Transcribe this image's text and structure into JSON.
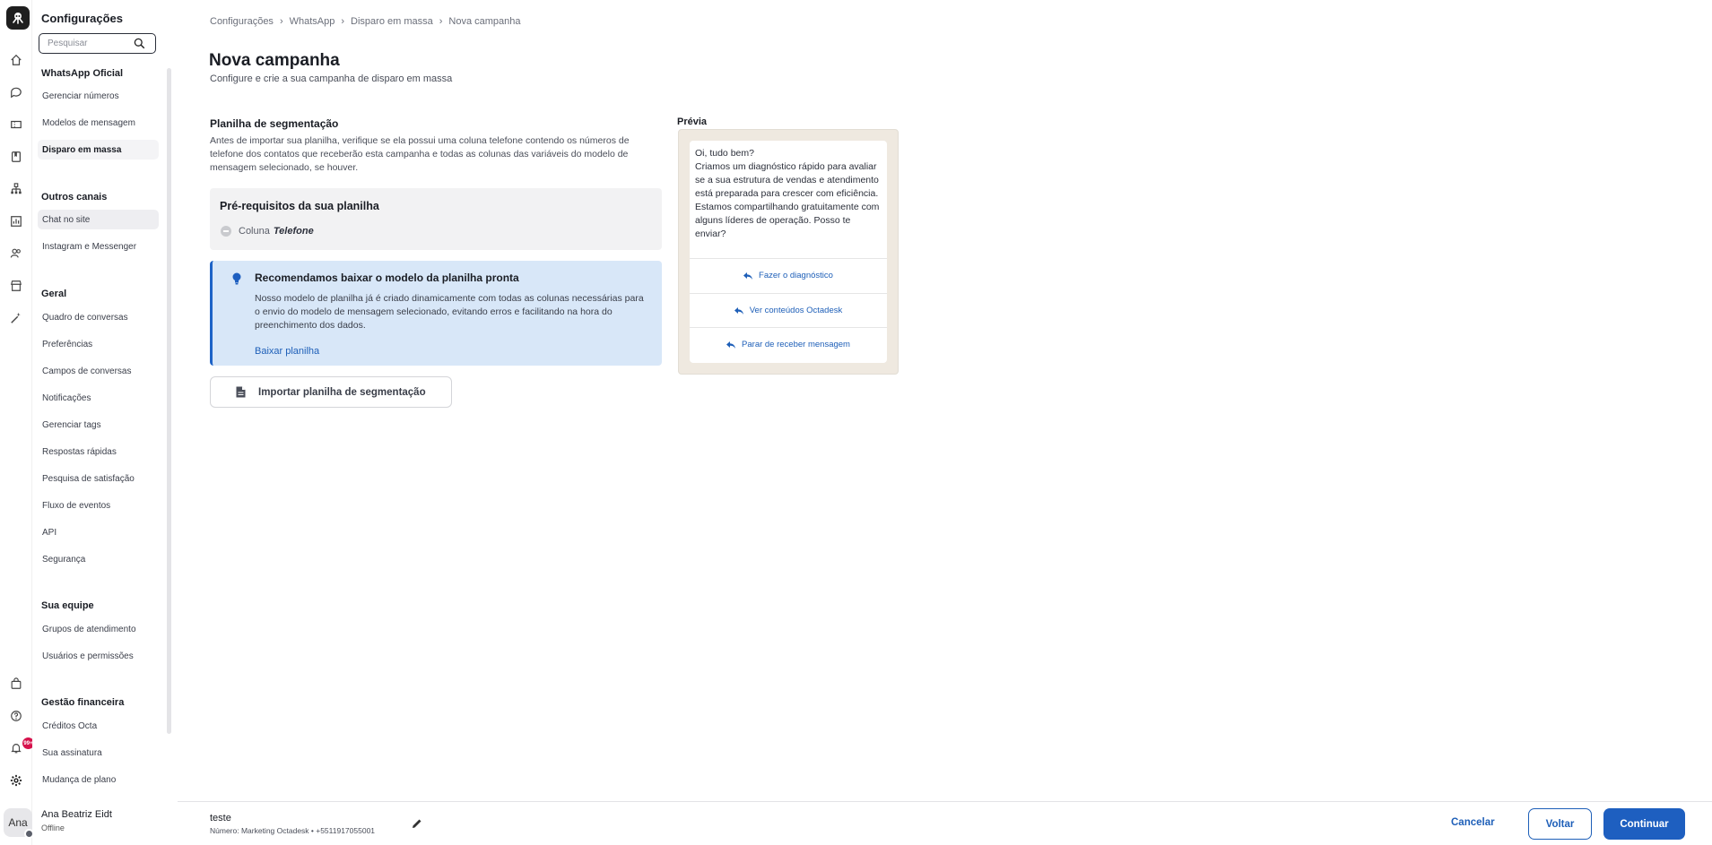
{
  "sidebar": {
    "title": "Configurações",
    "search_placeholder": "Pesquisar",
    "sections": [
      {
        "heading": "WhatsApp Oficial",
        "items": [
          "Gerenciar números",
          "Modelos de mensagem",
          "Disparo em massa"
        ]
      },
      {
        "heading": "Outros canais",
        "items": [
          "Chat no site",
          "Instagram e Messenger"
        ]
      },
      {
        "heading": "Geral",
        "items": [
          "Quadro de conversas",
          "Preferências",
          "Campos de conversas",
          "Notificações",
          "Gerenciar tags",
          "Respostas rápidas",
          "Pesquisa de satisfação",
          "Fluxo de eventos",
          "API",
          "Segurança"
        ]
      },
      {
        "heading": "Sua equipe",
        "items": [
          "Grupos de atendimento",
          "Usuários e permissões"
        ]
      },
      {
        "heading": "Gestão financeira",
        "items": [
          "Créditos Octa",
          "Sua assinatura",
          "Mudança de plano"
        ]
      }
    ],
    "active_item": "Disparo em massa"
  },
  "rail": {
    "notification_badge": "99+",
    "avatar_initials": "Ana"
  },
  "profile": {
    "name": "Ana Beatriz Eidt",
    "status": "Offline"
  },
  "breadcrumb": [
    "Configurações",
    "WhatsApp",
    "Disparo em massa",
    "Nova campanha"
  ],
  "page": {
    "title": "Nova campanha",
    "subtitle": "Configure e crie a sua campanha de disparo em massa"
  },
  "segmentation": {
    "title": "Planilha de segmentação",
    "description": "Antes de importar sua planilha, verifique se ela possui uma coluna telefone contendo os números de telefone dos contatos que receberão esta campanha e todas as colunas das variáveis do modelo de mensagem selecionado, se houver.",
    "prereq_title": "Pré-requisitos da sua planilha",
    "prereq_label": "Coluna",
    "prereq_value": "Telefone",
    "reco_title": "Recomendamos baixar o modelo da planilha pronta",
    "reco_text": "Nosso modelo de planilha já é criado dinamicamente com todas as colunas necessárias para o envio do modelo de mensagem selecionado, evitando erros e facilitando na hora do preenchimento dos dados.",
    "reco_link": "Baixar planilha",
    "import_button": "Importar planilha de segmentação"
  },
  "preview": {
    "label": "Prévia",
    "message": "Oi, tudo bem?\nCriamos um diagnóstico rápido para avaliar se a sua estrutura de vendas e atendimento está preparada para crescer com eficiência.\nEstamos compartilhando gratuitamente com alguns líderes de operação. Posso te enviar?",
    "replies": [
      "Fazer o diagnóstico",
      "Ver conteúdos Octadesk",
      "Parar de receber mensagem"
    ]
  },
  "footer": {
    "campaign_name": "teste",
    "number_info": "Número: Marketing Octadesk • +5511917055001",
    "cancel": "Cancelar",
    "back": "Voltar",
    "continue": "Continuar"
  },
  "colors": {
    "accent": "#1e5fc0",
    "reco_bg": "#d8e7f8",
    "preview_bg": "#efe9e0",
    "badge": "#d6124c"
  }
}
